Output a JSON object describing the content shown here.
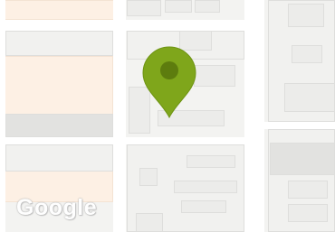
{
  "map": {
    "logo_text": "Google",
    "marker": {
      "icon": "map-pin-icon",
      "color": "#7fa61b",
      "dot_color": "#5d7c0e"
    },
    "colors": {
      "land": "#f3f3f1",
      "road": "#ffffff",
      "building": "#ececea",
      "highlight_area": "#fdf0e4"
    }
  }
}
